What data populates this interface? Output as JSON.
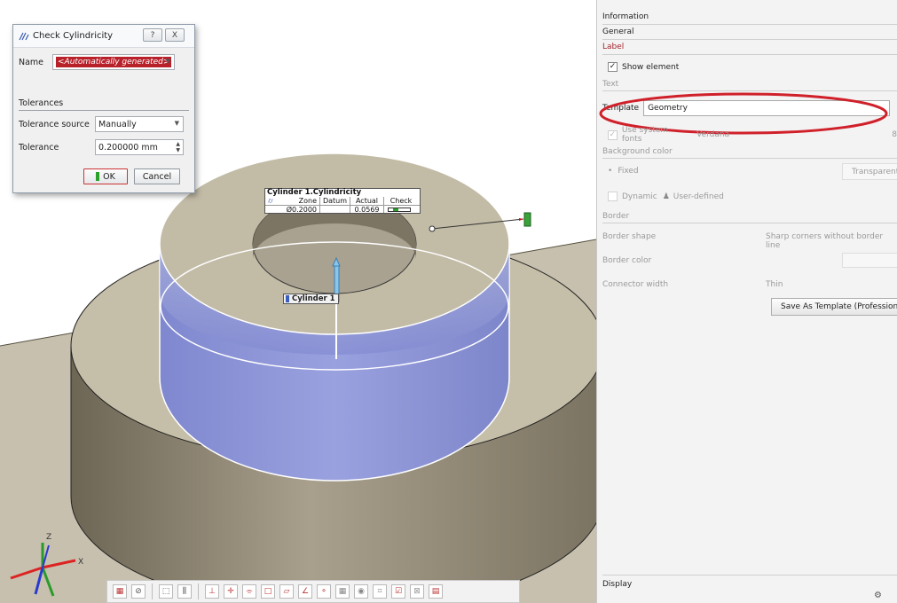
{
  "dialog": {
    "title": "Check Cylindricity",
    "help": "?",
    "close": "X",
    "name_label": "Name",
    "name_value": "<Automatically generated>",
    "tolerances_heading": "Tolerances",
    "tolerance_source_label": "Tolerance source",
    "tolerance_source_value": "Manually",
    "tolerance_label": "Tolerance",
    "tolerance_value": "0.200000 mm",
    "ok_label": "OK",
    "cancel_label": "Cancel"
  },
  "viewport": {
    "callout_title": "Cylinder 1.Cylindricity",
    "callout_headers": [
      "Zone",
      "Datum",
      "Actual",
      "Check"
    ],
    "callout_zone": "Ø0.2000",
    "callout_actual": "0.0569",
    "element_label": "Cylinder 1",
    "axis_x": "X",
    "axis_z": "Z"
  },
  "panel": {
    "information": "Information",
    "general": "General",
    "label_tab": "Label",
    "show_element": "Show element",
    "text_section": "Text",
    "template_label": "Template",
    "template_value": "Geometry",
    "use_system_fonts": "Use system fonts",
    "font_value": "Verdana",
    "font_size": "8",
    "background_color_section": "Background color",
    "fixed_label": "Fixed",
    "transparent_value": "Transparent",
    "dynamic_label": "Dynamic",
    "user_defined_value": "User-defined",
    "border_section": "Border",
    "border_shape_label": "Border shape",
    "border_shape_value": "Sharp corners without border line",
    "border_color_label": "Border color",
    "connector_width_label": "Connector width",
    "connector_width_value": "Thin",
    "save_template_button": "Save As Template (Professional",
    "display": "Display",
    "colors": {
      "accent_red": "#d0202a",
      "label_tab": "#a3252c"
    }
  }
}
